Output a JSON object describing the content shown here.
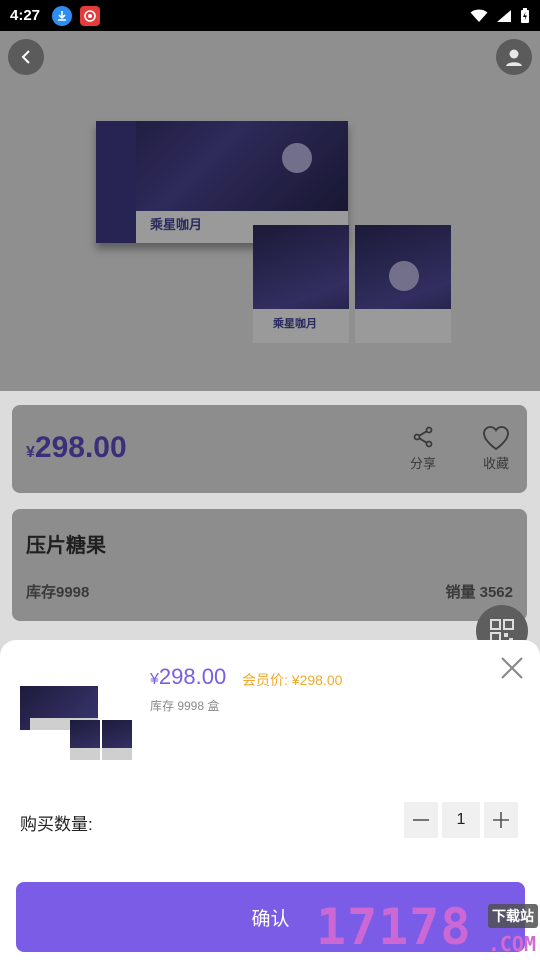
{
  "status_bar": {
    "time": "4:27"
  },
  "product": {
    "box_logo": "乘星咖月",
    "price_currency": "¥",
    "price_value": "298.00",
    "share_label": "分享",
    "favorite_label": "收藏",
    "title": "压片糖果",
    "stock_text": "库存9998",
    "sales_text": "销量 3562"
  },
  "sheet": {
    "price_currency": "¥",
    "price_value": "298.00",
    "member_price": "会员价: ¥298.00",
    "stock": "库存 9998 盒",
    "quantity_label": "购买数量:",
    "quantity": "1",
    "confirm_label": "确认"
  },
  "watermark": {
    "digits": "17178",
    "tag": "下载站",
    "suffix": ".COM"
  },
  "colors": {
    "accent": "#7b5ce6",
    "member": "#f0a92b",
    "watermark": "#d36ad2"
  }
}
